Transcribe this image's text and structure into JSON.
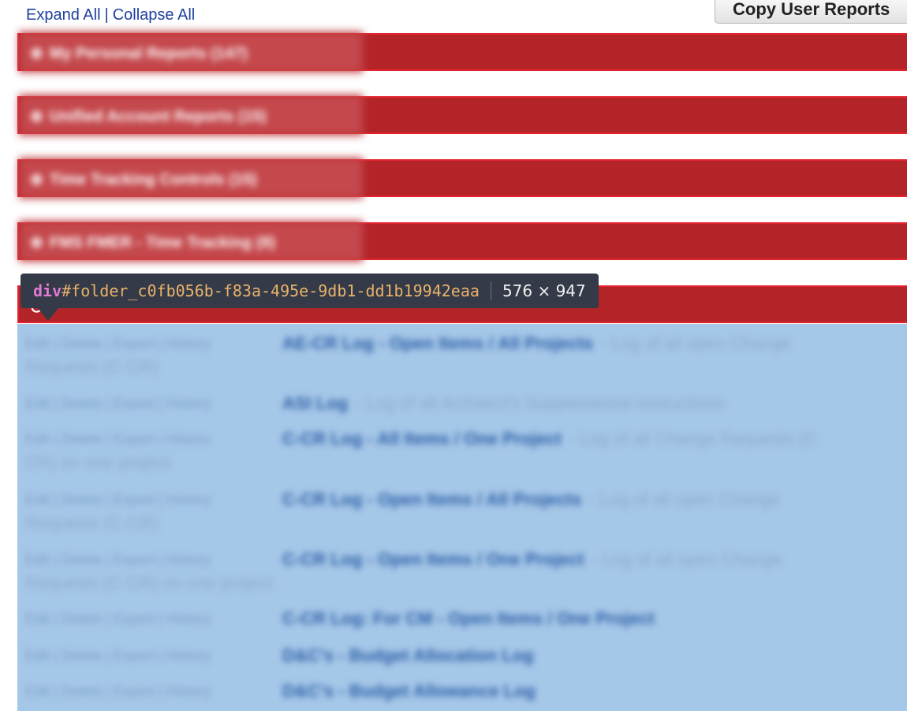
{
  "top_links": {
    "expand_all": "Expand All",
    "separator": "|",
    "collapse_all": "Collapse All"
  },
  "copy_button": {
    "label": "Copy User Reports"
  },
  "folders": [
    {
      "icon": "plus-icon",
      "label": "My Personal Reports (147)"
    },
    {
      "icon": "plus-icon",
      "label": "Unified Account Reports (15)"
    },
    {
      "icon": "plus-icon",
      "label": "Time Tracking Controls (15)"
    },
    {
      "icon": "plus-icon",
      "label": "FMS FMER - Time Tracking (8)"
    }
  ],
  "open_folder": {
    "icon": "minus-icon"
  },
  "inspector_tooltip": {
    "tag": "div",
    "id": "#folder_c0fb056b-f83a-495e-9db1-dd1b19942eaa",
    "size": "576 × 947"
  },
  "report_actions": "Edit | Delete | Export | History",
  "reports": [
    {
      "name": "AE-CR Log - Open Items / All Projects",
      "desc": "- Log of all open Change",
      "wrap": "Requests (C-CR)"
    },
    {
      "name": "ASI Log",
      "desc": "- Log of all Architect's Supplemental Instructions",
      "wrap": ""
    },
    {
      "name": "C-CR Log - All Items / One Project",
      "desc": "- Log of all Change Requests (C",
      "wrap": "CR) on one project"
    },
    {
      "name": "C-CR Log - Open Items / All Projects",
      "desc": "- Log of all open Change",
      "wrap": "Requests (C-CR)"
    },
    {
      "name": "C-CR Log - Open Items / One Project",
      "desc": "- Log of all open Change",
      "wrap": "Requests (C-CR) on one project"
    },
    {
      "name": "C-CR Log: For CM - Open Items / One Project",
      "desc": "",
      "wrap": ""
    },
    {
      "name": "D&C's - Budget Allocation Log",
      "desc": "",
      "wrap": ""
    },
    {
      "name": "D&C's - Budget Allowance Log",
      "desc": "",
      "wrap": ""
    }
  ],
  "colors": {
    "folder_bar": "#b32429",
    "folder_border": "#e3232e",
    "content_highlight": "#a5c7e8",
    "link": "#1f3f9f",
    "tooltip_bg": "#343a47"
  }
}
